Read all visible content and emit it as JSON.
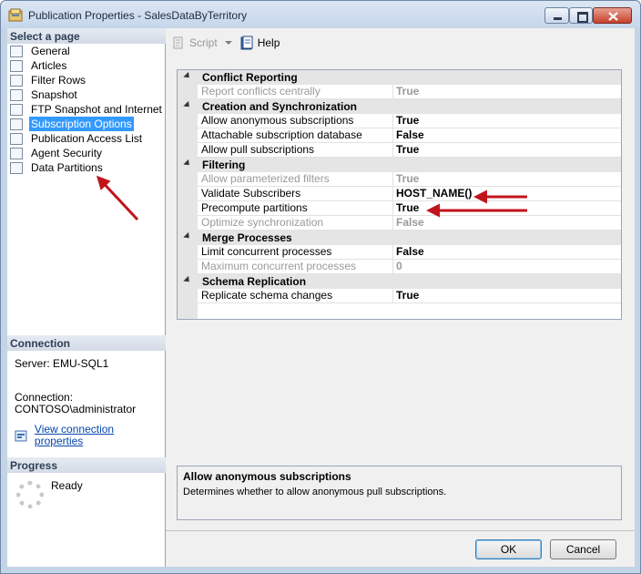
{
  "window": {
    "title": "Publication Properties - SalesDataByTerritory"
  },
  "left": {
    "select_heading": "Select a page",
    "pages": [
      {
        "label": "General",
        "icon": "page-icon"
      },
      {
        "label": "Articles",
        "icon": "page-icon"
      },
      {
        "label": "Filter Rows",
        "icon": "filter-icon"
      },
      {
        "label": "Snapshot",
        "icon": "page-icon"
      },
      {
        "label": "FTP Snapshot and Internet",
        "icon": "page-icon"
      },
      {
        "label": "Subscription Options",
        "icon": "page-icon",
        "selected": true
      },
      {
        "label": "Publication Access List",
        "icon": "users-icon"
      },
      {
        "label": "Agent Security",
        "icon": "key-icon"
      },
      {
        "label": "Data Partitions",
        "icon": "partition-icon"
      }
    ],
    "connection_heading": "Connection",
    "server": "Server: EMU-SQL1",
    "connection_label": "Connection:",
    "connection_value": "CONTOSO\\administrator",
    "view_connection": "View connection properties",
    "progress_heading": "Progress",
    "progress_status": "Ready"
  },
  "toolbar": {
    "script_label": "Script",
    "help_label": "Help"
  },
  "grid": {
    "categories": [
      {
        "title": "Conflict Reporting",
        "props": [
          {
            "name": "Report conflicts centrally",
            "value": "True",
            "disabled": true
          }
        ]
      },
      {
        "title": "Creation and Synchronization",
        "props": [
          {
            "name": "Allow anonymous subscriptions",
            "value": "True",
            "disabled": false
          },
          {
            "name": "Attachable subscription database",
            "value": "False",
            "disabled": false
          },
          {
            "name": "Allow pull subscriptions",
            "value": "True",
            "disabled": false
          }
        ]
      },
      {
        "title": "Filtering",
        "props": [
          {
            "name": "Allow parameterized filters",
            "value": "True",
            "disabled": true
          },
          {
            "name": "Validate Subscribers",
            "value": "HOST_NAME()",
            "disabled": false
          },
          {
            "name": "Precompute partitions",
            "value": "True",
            "disabled": false
          },
          {
            "name": "Optimize synchronization",
            "value": "False",
            "disabled": true
          }
        ]
      },
      {
        "title": "Merge Processes",
        "props": [
          {
            "name": "Limit concurrent processes",
            "value": "False",
            "disabled": false
          },
          {
            "name": "Maximum concurrent processes",
            "value": "0",
            "disabled": true
          }
        ]
      },
      {
        "title": "Schema Replication",
        "props": [
          {
            "name": "Replicate schema changes",
            "value": "True",
            "disabled": false
          }
        ]
      }
    ]
  },
  "description": {
    "title": "Allow anonymous subscriptions",
    "text": "Determines whether to allow anonymous pull subscriptions."
  },
  "buttons": {
    "ok": "OK",
    "cancel": "Cancel"
  },
  "colors": {
    "selection": "#3399ff",
    "annotation_arrow": "#c0141c"
  }
}
